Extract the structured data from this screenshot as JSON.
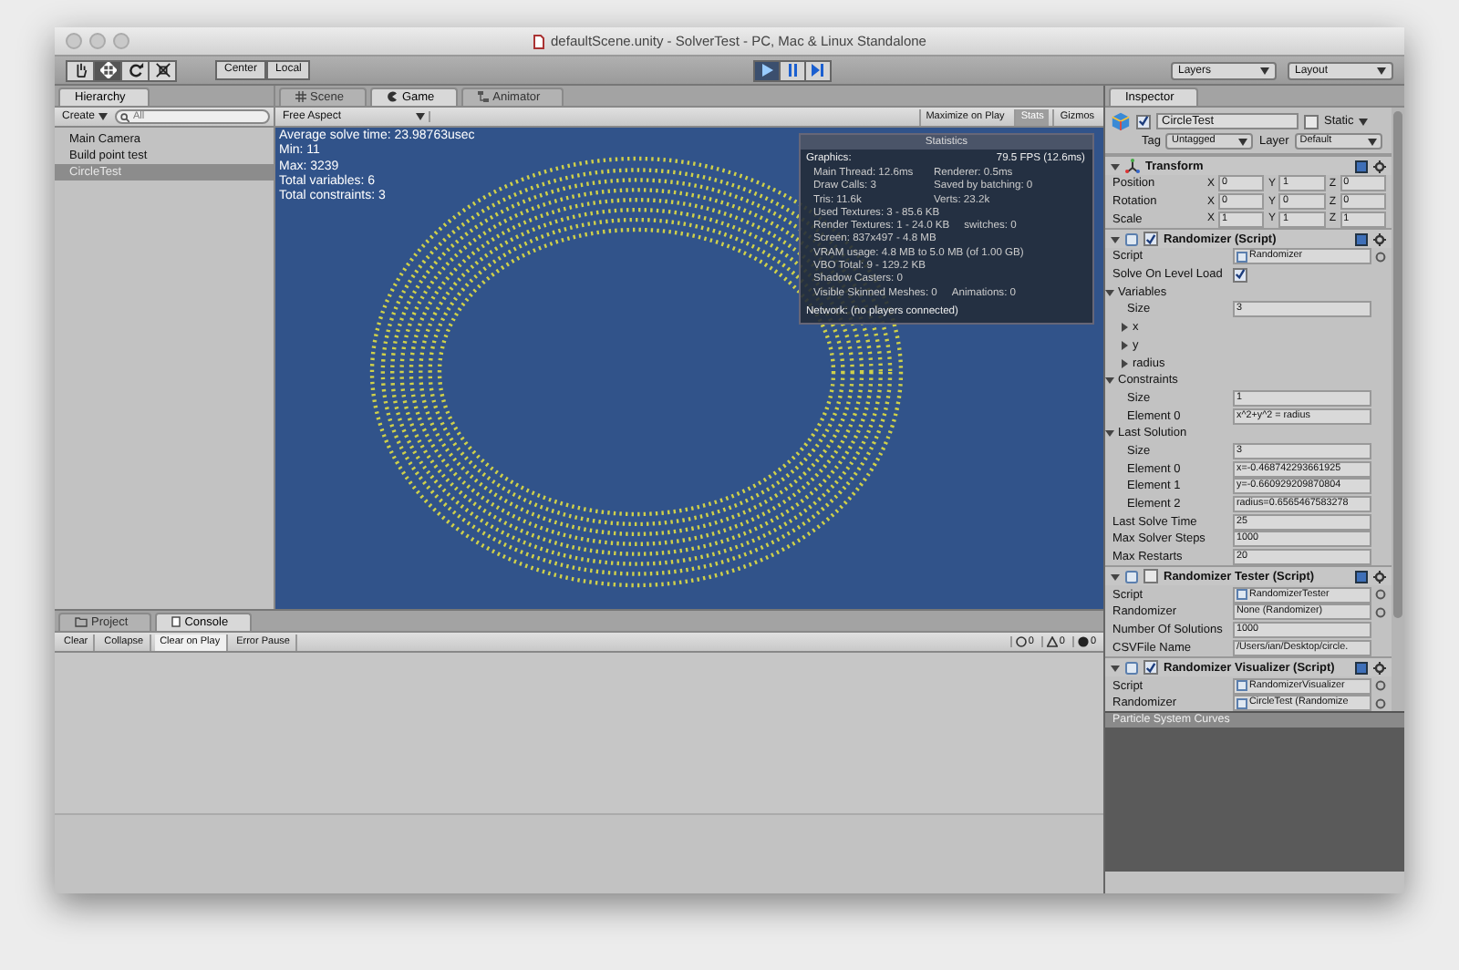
{
  "window": {
    "title": "defaultScene.unity - SolverTest - PC, Mac & Linux Standalone"
  },
  "toolbar": {
    "tools": [
      {
        "kind": "hand",
        "selected": false
      },
      {
        "kind": "move",
        "selected": true
      },
      {
        "kind": "rotate",
        "selected": false
      },
      {
        "kind": "scale",
        "selected": false
      }
    ],
    "pivot": [
      "Center",
      "Local"
    ],
    "play_controls": [
      {
        "kind": "play",
        "selected": true
      },
      {
        "kind": "pause",
        "selected": false
      },
      {
        "kind": "step",
        "selected": false
      }
    ],
    "layers": "Layers",
    "layout": "Layout"
  },
  "hierarchy": {
    "tab": "Hierarchy",
    "create": "Create",
    "search": {
      "placeholder": "All"
    },
    "items": [
      {
        "label": "Main Camera",
        "selected": false
      },
      {
        "label": "Build point test",
        "selected": false
      },
      {
        "label": "CircleTest",
        "selected": true
      }
    ]
  },
  "view_tabs": [
    {
      "label": "Scene",
      "kind": "scene",
      "selected": false
    },
    {
      "label": "Game",
      "kind": "game",
      "selected": true
    },
    {
      "label": "Animator",
      "kind": "animator",
      "selected": false
    }
  ],
  "game": {
    "aspect": "Free Aspect",
    "buttons": [
      {
        "label": "Maximize on Play",
        "selected": false
      },
      {
        "label": "Stats",
        "selected": true
      },
      {
        "label": "Gizmos",
        "selected": false
      }
    ],
    "output": [
      "Average solve time: 23.98763usec",
      "Min: 11",
      "Max: 3239",
      "Total variables: 6",
      "Total constraints: 3"
    ],
    "statistics": {
      "title": "Statistics",
      "graphics": "Graphics:",
      "fps": "79.5 FPS (12.6ms)",
      "lines": [
        {
          "text": "Main Thread: 12.6ms",
          "aside": "Renderer: 0.5ms"
        },
        {
          "text": "Draw Calls: 3",
          "aside": "Saved by batching: 0"
        },
        {
          "text": "Tris: 11.6k",
          "aside": "Verts: 23.2k"
        },
        {
          "text": "Used Textures: 3 - 85.6 KB"
        },
        {
          "text": "Render Textures: 1 - 24.0 KB",
          "aside": "switches: 0"
        },
        {
          "text": "Screen: 837x497 - 4.8 MB"
        },
        {
          "text": "VRAM usage: 4.8 MB to 5.0 MB (of 1.00 GB)"
        },
        {
          "text": "VBO Total: 9 - 129.2 KB"
        },
        {
          "text": "Shadow Casters: 0"
        },
        {
          "text": "Visible Skinned Meshes: 0",
          "aside": "Animations: 0"
        }
      ],
      "network": "Network: (no players connected)"
    }
  },
  "console": {
    "tabs": [
      {
        "label": "Project",
        "kind": "project",
        "selected": false
      },
      {
        "label": "Console",
        "kind": "console",
        "selected": true
      }
    ],
    "buttons": [
      {
        "label": "Clear",
        "selected": false
      },
      {
        "label": "Collapse",
        "selected": false
      },
      {
        "label": "Clear on Play",
        "selected": true
      },
      {
        "label": "Error Pause",
        "selected": false
      }
    ],
    "counts": [
      {
        "kind": "info",
        "value": "0"
      },
      {
        "kind": "warning",
        "value": "0"
      },
      {
        "kind": "error",
        "value": "0"
      }
    ]
  },
  "inspector": {
    "tab": "Inspector",
    "object": {
      "name": "CircleTest",
      "active": true,
      "static_label": "Static",
      "static": false,
      "tag_label": "Tag",
      "tag": "Untagged",
      "layer_label": "Layer",
      "layer": "Default"
    },
    "components": [
      {
        "kind": "transform",
        "title": "Transform",
        "rows": [
          {
            "label": "Position",
            "values": [
              {
                "axis": "X",
                "value": "0"
              },
              {
                "axis": "Y",
                "value": "1"
              },
              {
                "axis": "Z",
                "value": "0"
              }
            ]
          },
          {
            "label": "Rotation",
            "values": [
              {
                "axis": "X",
                "value": "0"
              },
              {
                "axis": "Y",
                "value": "0"
              },
              {
                "axis": "Z",
                "value": "0"
              }
            ]
          },
          {
            "label": "Scale",
            "values": [
              {
                "axis": "X",
                "value": "1"
              },
              {
                "axis": "Y",
                "value": "1"
              },
              {
                "axis": "Z",
                "value": "1"
              }
            ]
          }
        ]
      },
      {
        "kind": "script",
        "title": "Randomizer (Script)",
        "enabled": true,
        "rows": [
          {
            "kind": "object",
            "label": "Script",
            "value": "Randomizer",
            "linked": true
          },
          {
            "kind": "toggle",
            "label": "Solve On Level Load",
            "checked": true
          },
          {
            "kind": "foldout",
            "label": "Variables",
            "expanded": true,
            "children": [
              {
                "kind": "field",
                "label": "Size",
                "value": "3"
              },
              {
                "kind": "foldout",
                "label": "x",
                "expanded": false
              },
              {
                "kind": "foldout",
                "label": "y",
                "expanded": false
              },
              {
                "kind": "foldout",
                "label": "radius",
                "expanded": false
              }
            ]
          },
          {
            "kind": "foldout",
            "label": "Constraints",
            "expanded": true,
            "children": [
              {
                "kind": "field",
                "label": "Size",
                "value": "1"
              },
              {
                "kind": "field",
                "label": "Element 0",
                "value": "x^2+y^2 = radius"
              }
            ]
          },
          {
            "kind": "foldout",
            "label": "Last Solution",
            "expanded": true,
            "children": [
              {
                "kind": "field",
                "label": "Size",
                "value": "3"
              },
              {
                "kind": "field",
                "label": "Element 0",
                "value": "x=-0.468742293661925"
              },
              {
                "kind": "field",
                "label": "Element 1",
                "value": "y=-0.660929209870804"
              },
              {
                "kind": "field",
                "label": "Element 2",
                "value": "radius=0.6565467583278"
              }
            ]
          },
          {
            "kind": "field",
            "label": "Last Solve Time",
            "value": "25"
          },
          {
            "kind": "field",
            "label": "Max Solver Steps",
            "value": "1000"
          },
          {
            "kind": "field",
            "label": "Max Restarts",
            "value": "20"
          }
        ]
      },
      {
        "kind": "script",
        "title": "Randomizer Tester (Script)",
        "enabled": false,
        "rows": [
          {
            "kind": "object",
            "label": "Script",
            "value": "RandomizerTester",
            "linked": true
          },
          {
            "kind": "object",
            "label": "Randomizer",
            "value": "None (Randomizer)",
            "linked": false
          },
          {
            "kind": "field",
            "label": "Number Of Solutions",
            "value": "1000"
          },
          {
            "kind": "field",
            "label": "CSVFile Name",
            "value": "/Users/ian/Desktop/circle."
          }
        ]
      },
      {
        "kind": "script",
        "title": "Randomizer Visualizer (Script)",
        "enabled": true,
        "rows": [
          {
            "kind": "object",
            "label": "Script",
            "value": "RandomizerVisualizer",
            "linked": true
          },
          {
            "kind": "object",
            "label": "Randomizer",
            "value": "CircleTest (Randomize",
            "linked": true
          }
        ]
      }
    ]
  },
  "curves": {
    "title": "Particle System Curves"
  }
}
